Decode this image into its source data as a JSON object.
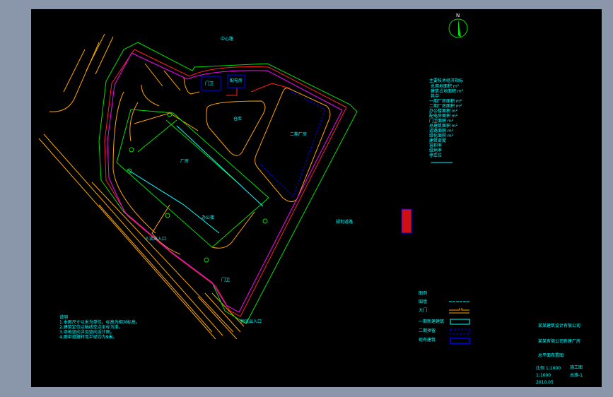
{
  "viewer": {
    "background_color": "#8a97aa",
    "drawing_background": "#000000"
  },
  "drawing": {
    "north_label": "N",
    "road_label_top": "中心路",
    "road_label_right": "规划道路",
    "buildings": {
      "guard_house": "门卫",
      "power_room": "配电房",
      "warehouse": "仓库",
      "factory_2": "二期厂房",
      "factory_1": "厂房",
      "office": "办公楼",
      "guard_house_2": "门卫"
    },
    "entrance_label": "人流出入口",
    "exit_label": "物流出入口",
    "stamp_text": "图纸专用章",
    "specs": {
      "title": "主要技术经济指标",
      "rows": [
        "总用地面积 m²",
        "建筑占地面积 m²",
        "其中",
        "一期厂房面积 m²",
        "二期厂房面积 m²",
        "办公楼面积 m²",
        "配电房面积 m²",
        "门卫面积 m²",
        "总建筑面积 m²",
        "道路面积 m²",
        "绿化面积 m²",
        "建筑密度",
        "容积率",
        "绿地率",
        "停车位"
      ]
    },
    "notes": {
      "title": "说明",
      "lines": [
        "1.本图尺寸以米为单位，标高为相对标高。",
        "2.建筑定位以轴线交点坐标为准。",
        "3.场地竖向详见竖向设计图。",
        "4.图中道路转弯半径均为9米。"
      ]
    },
    "legend": {
      "title": "图例",
      "items": [
        {
          "label": "围墙",
          "symbol": "fence"
        },
        {
          "label": "大门",
          "symbol": "gate"
        },
        {
          "label": "一期新建建筑",
          "symbol": "new"
        },
        {
          "label": "二期预留",
          "symbol": "reserved"
        },
        {
          "label": "现有建筑",
          "symbol": "existing"
        }
      ]
    },
    "title_block": {
      "company": "某某建筑设计有限公司",
      "project": "某某有限公司新建厂房",
      "drawing_name": "总平面布置图",
      "scale_label": "比例 1:1000",
      "scale": "1:1000",
      "date": "2010.05",
      "stage": "施工图",
      "number": "总施-1"
    }
  }
}
